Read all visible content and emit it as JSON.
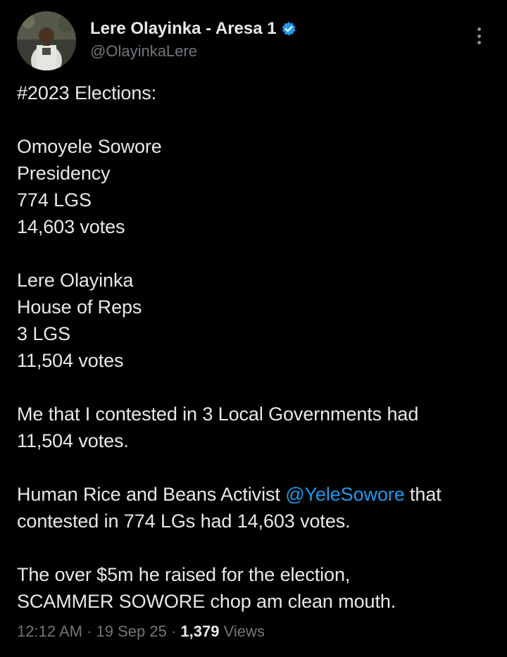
{
  "author": {
    "display_name": "Lere Olayinka - Aresa 1",
    "handle": "@OlayinkaLere",
    "verified": true
  },
  "icons": {
    "verified": "verified-badge-icon",
    "more": "more-options-icon"
  },
  "colors": {
    "background": "#000000",
    "text": "#e7e9ea",
    "muted": "#71767b",
    "link": "#1d9bf0",
    "verified": "#1d9bf0"
  },
  "tweet": {
    "p1": {
      "l1": "#2023 Elections:"
    },
    "p2": {
      "l1": "Omoyele Sowore",
      "l2": "Presidency",
      "l3": "774 LGS",
      "l4": "14,603 votes"
    },
    "p3": {
      "l1": "Lere Olayinka",
      "l2": "House of Reps",
      "l3": "3 LGS",
      "l4": "11,504 votes"
    },
    "p4": {
      "l1": "Me that I contested in 3 Local Governments had",
      "l2": "11,504 votes."
    },
    "p5": {
      "l1_before": "Human Rice and Beans Activist ",
      "l1_mention": "@YeleSowore",
      "l1_after": " that",
      "l2": "contested in 774 LGs had 14,603 votes."
    },
    "p6": {
      "l1": "The over $5m he raised for the election,",
      "l2": "SCAMMER SOWORE chop am clean mouth."
    }
  },
  "meta": {
    "time": "12:12 AM",
    "sep1": " · ",
    "date": "19 Sep 25",
    "sep2": " · ",
    "views_count": "1,379",
    "views_label": " Views"
  }
}
